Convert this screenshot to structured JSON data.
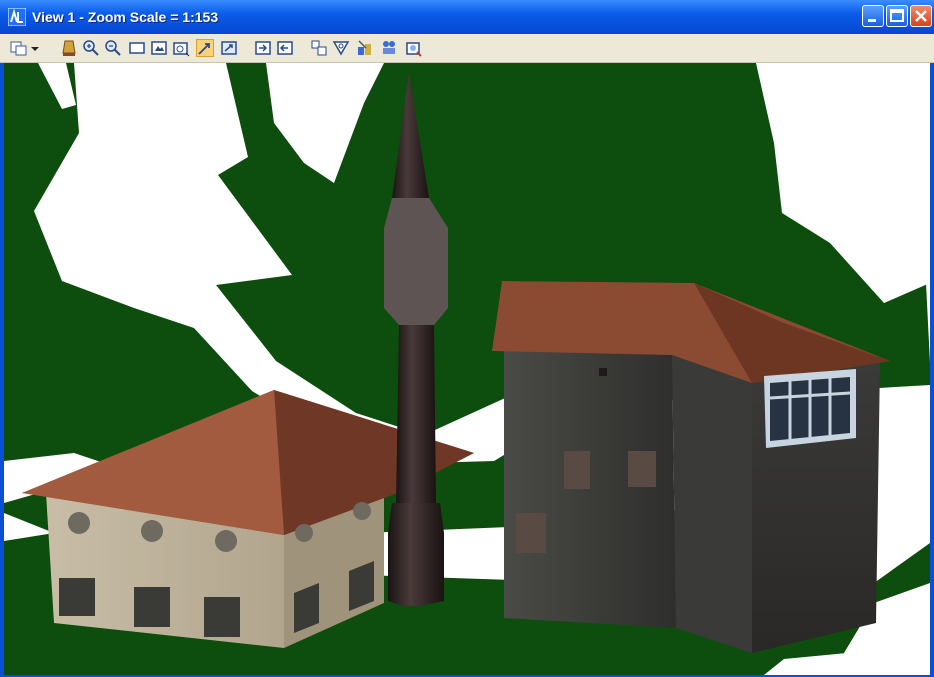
{
  "window": {
    "title": "View 1 - Zoom Scale = 1:153"
  },
  "titlebar": {
    "minimize_icon": "minimize-icon",
    "maximize_icon": "maximize-icon",
    "close_icon": "close-icon"
  },
  "toolbar": {
    "tools": [
      "view-control-icon",
      "dropdown-icon",
      "update-view-icon",
      "zoom-in-icon",
      "zoom-out-icon",
      "window-area-icon",
      "fit-view-icon",
      "rotate-view-icon",
      "pan-view-icon",
      "view-previous-icon",
      "view-next-icon",
      "copy-view-icon",
      "view-attributes-icon",
      "clip-volume-icon",
      "display-style-icon",
      "camera-icon",
      "render-icon"
    ],
    "active_tool": "pan-view-icon"
  },
  "scene": {
    "ground_color": "#0d4d0d",
    "sky_color": "#ffffff",
    "roof_color": "#8a4a32",
    "minaret_color": "#2e2222"
  }
}
